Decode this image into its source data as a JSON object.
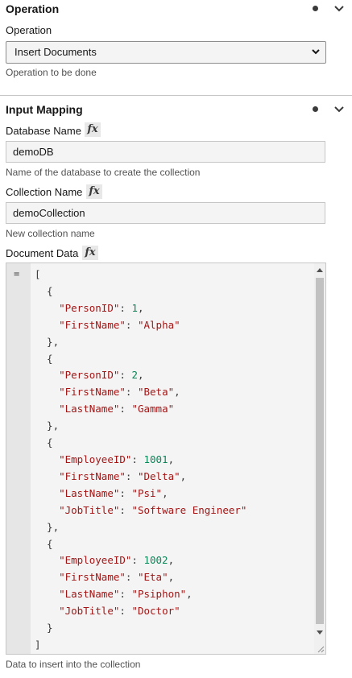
{
  "operation_section": {
    "title": "Operation",
    "field_label": "Operation",
    "selected": "Insert Documents",
    "helper": "Operation to be done"
  },
  "input_mapping": {
    "title": "Input Mapping",
    "fx_label": "fx",
    "database": {
      "label": "Database Name",
      "value": "demoDB",
      "helper": "Name of the database to create the collection"
    },
    "collection": {
      "label": "Collection Name",
      "value": "demoCollection",
      "helper": "New collection name"
    },
    "document": {
      "label": "Document Data",
      "helper": "Data to insert into the collection",
      "fold_marker": "=",
      "lines": [
        "[",
        "  {",
        "    \"PersonID\": 1,",
        "    \"FirstName\": \"Alpha\"",
        "  },",
        "  {",
        "    \"PersonID\": 2,",
        "    \"FirstName\": \"Beta\",",
        "    \"LastName\": \"Gamma\"",
        "  },",
        "  {",
        "    \"EmployeeID\": 1001,",
        "    \"FirstName\": \"Delta\",",
        "    \"LastName\": \"Psi\",",
        "    \"JobTitle\": \"Software Engineer\"",
        "  },",
        "  {",
        "    \"EmployeeID\": 1002,",
        "    \"FirstName\": \"Eta\",",
        "    \"LastName\": \"Psiphon\",",
        "    \"JobTitle\": \"Doctor\"",
        "  }",
        "]"
      ]
    }
  },
  "colors": {
    "string": "#a31515",
    "number": "#098658",
    "punctuation": "#393939"
  }
}
